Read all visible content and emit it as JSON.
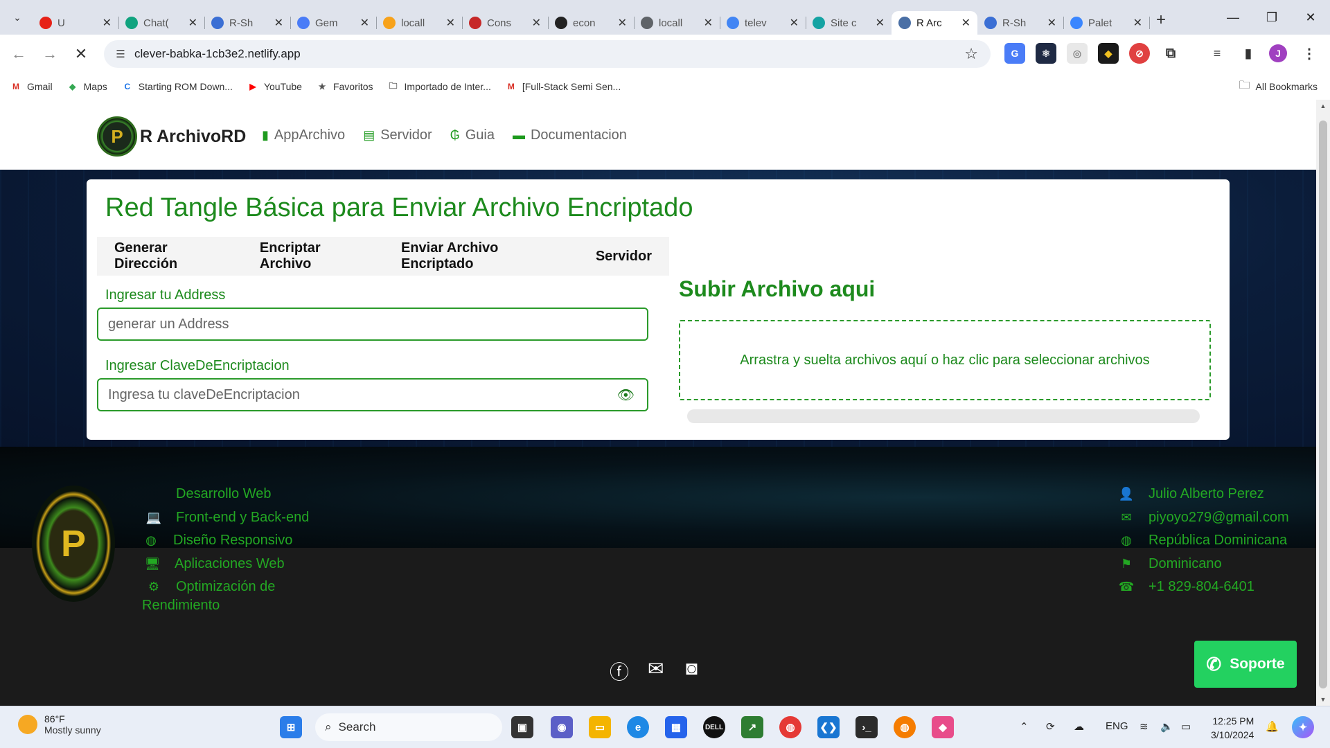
{
  "browser": {
    "tabs": [
      {
        "label": "U",
        "fav": "youtube-icon",
        "color": "#e62117"
      },
      {
        "label": "Chat(",
        "fav": "chatgpt-icon",
        "color": "#10a37f"
      },
      {
        "label": "R-Sh",
        "fav": "r-icon",
        "color": "#3b6fd4"
      },
      {
        "label": "Gem",
        "fav": "gemini-icon",
        "color": "#4a7cf7"
      },
      {
        "label": "locall",
        "fav": "phpmyadmin-icon",
        "color": "#f7a21b"
      },
      {
        "label": "Cons",
        "fav": "console-icon",
        "color": "#c62828"
      },
      {
        "label": "econ",
        "fav": "github-icon",
        "color": "#222222"
      },
      {
        "label": "locall",
        "fav": "globe-icon",
        "color": "#5f6368"
      },
      {
        "label": "telev",
        "fav": "google-icon",
        "color": "#4285f4"
      },
      {
        "label": "Site c",
        "fav": "netlify-icon",
        "color": "#14a3a3"
      },
      {
        "label": "R Arc",
        "fav": "site-icon",
        "color": "#4a6fa5",
        "active": true
      },
      {
        "label": "R-Sh",
        "fav": "r-icon",
        "color": "#3b6fd4"
      },
      {
        "label": "Palet",
        "fav": "palette-icon",
        "color": "#3a86ff"
      }
    ],
    "url": "clever-babka-1cb3e2.netlify.app",
    "bookmarks": [
      {
        "label": "Gmail",
        "icon": "gmail-icon"
      },
      {
        "label": "Maps",
        "icon": "maps-icon"
      },
      {
        "label": "Starting ROM Down...",
        "icon": "c-icon"
      },
      {
        "label": "YouTube",
        "icon": "youtube-icon"
      },
      {
        "label": "Favoritos",
        "icon": "star-icon"
      },
      {
        "label": "Importado de Inter...",
        "icon": "folder-icon"
      },
      {
        "label": "[Full-Stack Semi Sen...",
        "icon": "gmail-icon"
      }
    ],
    "all_bookmarks": "All Bookmarks",
    "profile_initial": "J"
  },
  "site": {
    "brand": "R ArchivoRD",
    "brand_logo_letter": "P",
    "nav": [
      {
        "label": "AppArchivo",
        "icon": "file-icon"
      },
      {
        "label": "Servidor",
        "icon": "server-icon"
      },
      {
        "label": "Guia",
        "icon": "guarani-icon"
      },
      {
        "label": "Documentacion",
        "icon": "folder-icon"
      }
    ],
    "title": "Red Tangle Básica para Enviar Archivo Encriptado",
    "tabs": [
      "Generar Dirección",
      "Encriptar Archivo",
      "Enviar Archivo Encriptado",
      "Servidor"
    ],
    "address_label": "Ingresar tu Address",
    "address_placeholder": "generar un Address",
    "key_label": "Ingresar ClaveDeEncriptacion",
    "key_placeholder": "Ingresa tu claveDeEncriptacion",
    "upload_title": "Subir Archivo aqui",
    "dropzone_text": "Arrastra y suelta archivos aquí o haz clic para seleccionar archivos",
    "upload_progress": 0
  },
  "footer": {
    "logo_letter": "P",
    "services": [
      {
        "label": "Desarrollo Web",
        "icon": "code-icon"
      },
      {
        "label": "Front-end y Back-end",
        "icon": "laptop-icon"
      },
      {
        "label": "Diseño Responsivo",
        "icon": "globe-icon"
      },
      {
        "label": "Aplicaciones Web",
        "icon": "desktop-icon"
      },
      {
        "label": "Optimización de",
        "icon": "gears-icon"
      }
    ],
    "services_wrap": "Rendimiento",
    "contact": [
      {
        "label": "Julio Alberto Perez",
        "icon": "user-icon"
      },
      {
        "label": "piyoyo279@gmail.com",
        "icon": "envelope-icon"
      },
      {
        "label": "República Dominicana",
        "icon": "globe-icon"
      },
      {
        "label": "Dominicano",
        "icon": "flag-icon"
      },
      {
        "label": "+1 829-804-6401",
        "icon": "phone-icon"
      }
    ],
    "social": [
      "facebook-icon",
      "envelope-icon",
      "instagram-icon"
    ],
    "support": "Soporte"
  },
  "taskbar": {
    "weather_temp": "86°F",
    "weather_desc": "Mostly sunny",
    "search": "Search",
    "lang": "ENG",
    "time": "12:25 PM",
    "date": "3/10/2024"
  },
  "colors": {
    "accent": "#1d8a1d",
    "support": "#23d160",
    "footer": "#1b1b1b"
  }
}
